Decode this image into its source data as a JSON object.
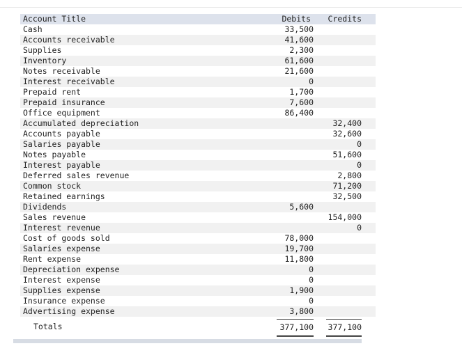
{
  "header": {
    "title": "Account Title",
    "debits": "Debits",
    "credits": "Credits"
  },
  "rows": [
    {
      "title": "Cash",
      "debit": "33,500",
      "credit": ""
    },
    {
      "title": "Accounts receivable",
      "debit": "41,600",
      "credit": ""
    },
    {
      "title": "Supplies",
      "debit": "2,300",
      "credit": ""
    },
    {
      "title": "Inventory",
      "debit": "61,600",
      "credit": ""
    },
    {
      "title": "Notes receivable",
      "debit": "21,600",
      "credit": ""
    },
    {
      "title": "Interest receivable",
      "debit": "0",
      "credit": ""
    },
    {
      "title": "Prepaid rent",
      "debit": "1,700",
      "credit": ""
    },
    {
      "title": "Prepaid insurance",
      "debit": "7,600",
      "credit": ""
    },
    {
      "title": "Office equipment",
      "debit": "86,400",
      "credit": ""
    },
    {
      "title": "Accumulated depreciation",
      "debit": "",
      "credit": "32,400"
    },
    {
      "title": "Accounts payable",
      "debit": "",
      "credit": "32,600"
    },
    {
      "title": "Salaries payable",
      "debit": "",
      "credit": "0"
    },
    {
      "title": "Notes payable",
      "debit": "",
      "credit": "51,600"
    },
    {
      "title": "Interest payable",
      "debit": "",
      "credit": "0"
    },
    {
      "title": "Deferred sales revenue",
      "debit": "",
      "credit": "2,800"
    },
    {
      "title": "Common stock",
      "debit": "",
      "credit": "71,200"
    },
    {
      "title": "Retained earnings",
      "debit": "",
      "credit": "32,500"
    },
    {
      "title": "Dividends",
      "debit": "5,600",
      "credit": ""
    },
    {
      "title": "Sales revenue",
      "debit": "",
      "credit": "154,000"
    },
    {
      "title": "Interest revenue",
      "debit": "",
      "credit": "0"
    },
    {
      "title": "Cost of goods sold",
      "debit": "78,000",
      "credit": ""
    },
    {
      "title": "Salaries expense",
      "debit": "19,700",
      "credit": ""
    },
    {
      "title": "Rent expense",
      "debit": "11,800",
      "credit": ""
    },
    {
      "title": "Depreciation expense",
      "debit": "0",
      "credit": ""
    },
    {
      "title": "Interest expense",
      "debit": "0",
      "credit": ""
    },
    {
      "title": "Supplies expense",
      "debit": "1,900",
      "credit": ""
    },
    {
      "title": "Insurance expense",
      "debit": "0",
      "credit": ""
    },
    {
      "title": "Advertising expense",
      "debit": "3,800",
      "credit": ""
    }
  ],
  "totals": {
    "label": "Totals",
    "debit": "377,100",
    "credit": "377,100"
  }
}
